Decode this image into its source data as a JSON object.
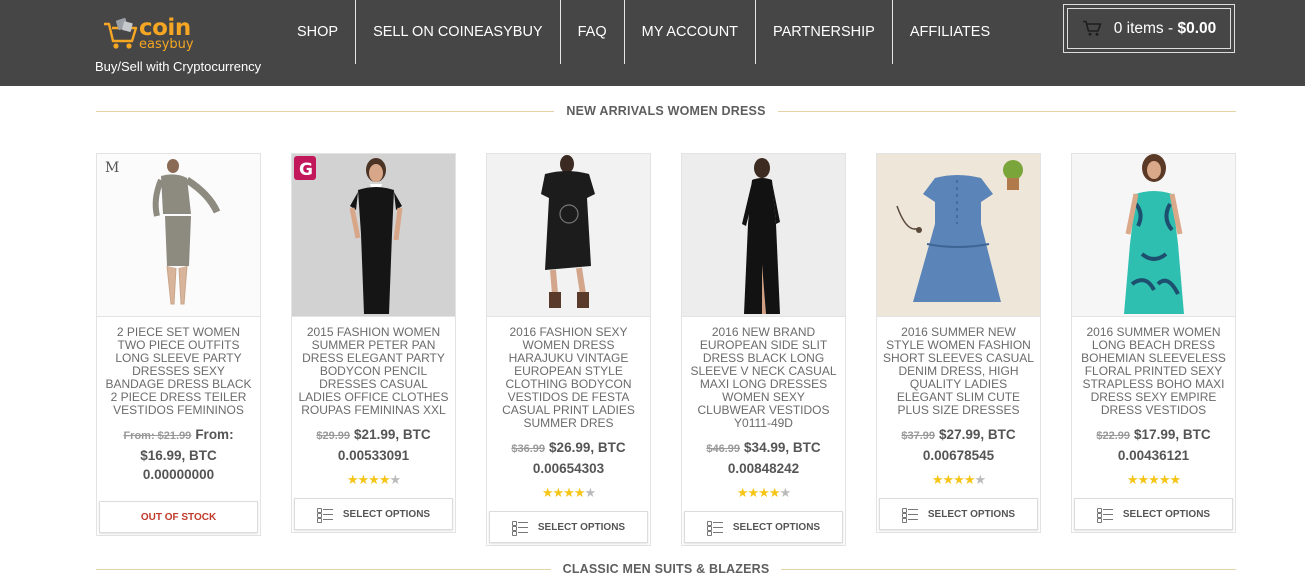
{
  "header": {
    "logo_coin": "coin",
    "logo_easy": "easybuy",
    "tagline": "Buy/Sell with Cryptocurrency",
    "nav": [
      "SHOP",
      "SELL ON COINEASYBUY",
      "FAQ",
      "MY ACCOUNT",
      "PARTNERSHIP",
      "AFFILIATES"
    ],
    "cart": {
      "items": "0 items",
      "separator": "-",
      "total": "$0.00"
    }
  },
  "sections": {
    "new_arrivals": "NEW ARRIVALS WOMEN DRESS",
    "classic_men": "CLASSIC MEN SUITS & BLAZERS"
  },
  "products": [
    {
      "title": "2 PIECE SET WOMEN TWO PIECE OUTFITS LONG SLEEVE PARTY DRESSES SEXY BANDAGE DRESS BLACK 2 PIECE DRESS TEILER VESTIDOS FEMININOS",
      "old_price": "From: $21.99",
      "price": "From: $16.99, BTC 0.00000000",
      "rating": 0,
      "action": "OUT OF STOCK",
      "image_watermark": "M"
    },
    {
      "title": "2015 FASHION WOMEN SUMMER PETER PAN DRESS ELEGANT PARTY BODYCON PENCIL DRESSES CASUAL LADIES OFFICE CLOTHES ROUPAS FEMININAS XXL",
      "old_price": "$29.99",
      "price": "$21.99, BTC 0.00533091",
      "rating": 4.5,
      "action": "SELECT OPTIONS",
      "image_watermark": "G"
    },
    {
      "title": "2016 FASHION SEXY WOMEN DRESS HARAJUKU VINTAGE EUROPEAN STYLE CLOTHING BODYCON VESTIDOS DE FESTA CASUAL PRINT LADIES SUMMER DRES",
      "old_price": "$36.99",
      "price": "$26.99, BTC 0.00654303",
      "rating": 4.5,
      "action": "SELECT OPTIONS",
      "image_watermark": ""
    },
    {
      "title": "2016 NEW BRAND EUROPEAN SIDE SLIT DRESS BLACK LONG SLEEVE V NECK CASUAL MAXI LONG DRESSES WOMEN SEXY CLUBWEAR VESTIDOS Y0111-49D",
      "old_price": "$46.99",
      "price": "$34.99, BTC 0.00848242",
      "rating": 4.5,
      "action": "SELECT OPTIONS",
      "image_watermark": ""
    },
    {
      "title": "2016 SUMMER NEW STYLE WOMEN FASHION SHORT SLEEVES CASUAL DENIM DRESS, HIGH QUALITY LADIES ELEGANT SLIM CUTE PLUS SIZE DRESSES",
      "old_price": "$37.99",
      "price": "$27.99, BTC 0.00678545",
      "rating": 4.5,
      "action": "SELECT OPTIONS",
      "image_watermark": ""
    },
    {
      "title": "2016 SUMMER WOMEN LONG BEACH DRESS BOHEMIAN SLEEVELESS FLORAL PRINTED SEXY STRAPLESS BOHO MAXI DRESS SEXY EMPIRE DRESS VESTIDOS",
      "old_price": "$22.99",
      "price": "$17.99, BTC 0.00436121",
      "rating": 5,
      "action": "SELECT OPTIONS",
      "image_watermark": ""
    }
  ],
  "icons": {
    "cart": "shopping-cart-icon",
    "select_options": "list-icon",
    "star": "star-icon"
  },
  "colors": {
    "header_bg": "#464646",
    "accent": "#f5a623",
    "star": "#f5c518",
    "out_of_stock": "#c0392b",
    "divider": "#e4d3a6"
  }
}
